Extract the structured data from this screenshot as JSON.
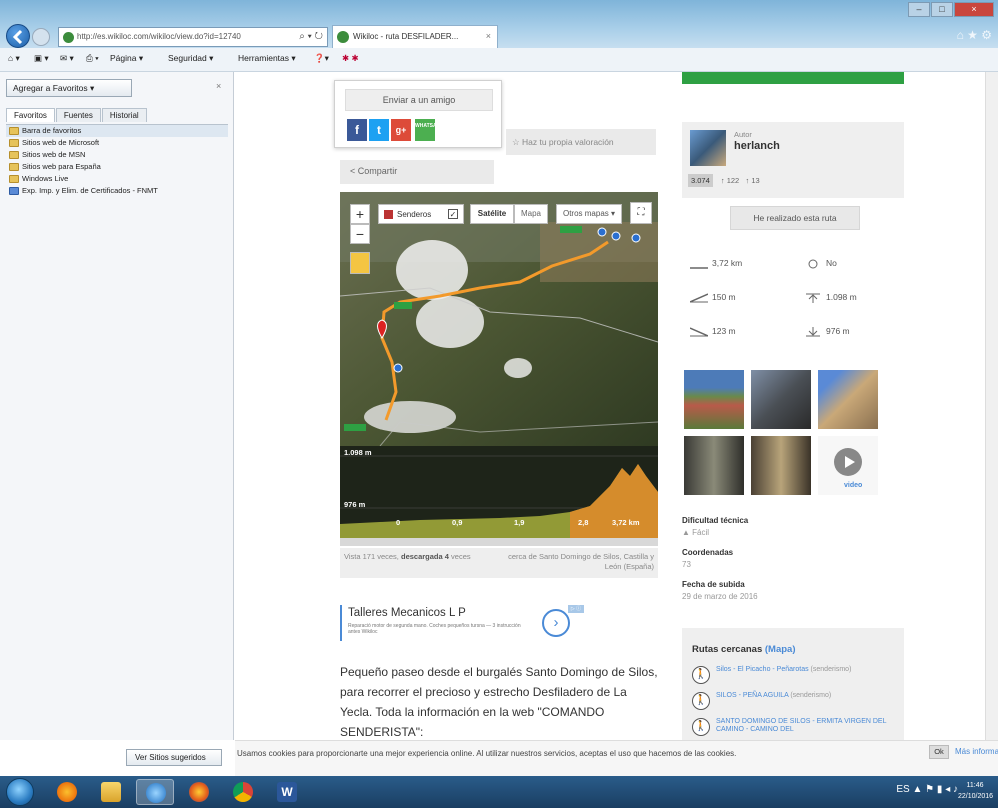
{
  "browser": {
    "address_url": "http://es.wikiloc.com/wikiloc/view.do?id=12740",
    "tab_title": "Wikiloc - ruta DESFILADER...",
    "cmd_items": [
      "Página ▾",
      "Seguridad ▾",
      "Herramientas ▾"
    ]
  },
  "favorites": {
    "add_button": "Agregar a Favoritos",
    "tabs": [
      "Favoritos",
      "Fuentes",
      "Historial"
    ],
    "items": [
      "Barra de favoritos",
      "Sitios web de Microsoft",
      "Sitios web de MSN",
      "Sitios web para España",
      "Windows Live",
      "Exp. Imp. y Elim. de Certificados - FNMT"
    ],
    "suggest_button": "Ver Sitios sugeridos"
  },
  "share": {
    "email_button": "Enviar a un amigo",
    "facebook": "f",
    "twitter": "t",
    "gplus": "g+",
    "whatsapp": "WHATSAPP",
    "compartir": "Compartir",
    "valorar": "Haz tu propia valoración"
  },
  "map": {
    "zoom_in": "+",
    "zoom_out": "−",
    "layer_label": "Senderos",
    "layer_check": "✓",
    "satellite": "Satélite",
    "map_view": "Mapa",
    "other_maps": "Otros mapas ▾",
    "fullscreen": "⛶",
    "profile_top": "1.098 m",
    "profile_bottom": "976 m",
    "x_ticks": [
      "0",
      "0,9",
      "1,9",
      "2,8",
      "3,72 km"
    ]
  },
  "views": {
    "prefix": "Vista 171 veces, ",
    "bold": "descargada 4",
    "suffix": " veces",
    "location": "cerca de Santo Domingo de Silos, Castilla y León (España)"
  },
  "ad": {
    "title": "Talleres Mecanicos L P",
    "sub": "Reparació motor de segunda mano. Coches pequeños tursna — 3 instrucción antes Wikiloc",
    "badge": "▷ ⓘ"
  },
  "description": "Pequeño paseo desde el burgalés Santo Domingo de Silos, para recorrer el precioso y estrecho Desfiladero de La Yecla. Toda la información en la web \"COMANDO SENDERISTA\":",
  "author": {
    "label": "Autor",
    "name": "herlanch",
    "points": "3.074",
    "followers": "↑ 122",
    "following": "↑ 13",
    "done_button": "He realizado esta ruta"
  },
  "stats": {
    "distance": "3,72 km",
    "loop": "No",
    "ascent": "150 m",
    "max_alt": "1.098 m",
    "descent": "123 m",
    "min_alt": "976 m"
  },
  "video_label": "video",
  "meta": {
    "difficulty_h": "Dificultad técnica",
    "difficulty_v": "▲ Fácil",
    "coords_h": "Coordenadas",
    "coords_v": "73",
    "date_h": "Fecha de subida",
    "date_v": "29 de marzo de 2016"
  },
  "nearby": {
    "heading": "Rutas cercanas ",
    "map_link": "(Mapa)",
    "items": [
      {
        "name": "Silos - El Picacho - Peñarotas",
        "type": " (senderismo)"
      },
      {
        "name": "SILOS - PEÑA AGUILA",
        "type": " (senderismo)"
      },
      {
        "name": "SANTO DOMINGO DE SILOS - ERMITA VIRGEN DEL CAMINO - CAMINO DEL",
        "type": ""
      }
    ]
  },
  "cookie": {
    "text": "Usamos cookies para proporcionarte una mejor experiencia online. Al utilizar nuestros servicios, aceptas el uso que hacemos de las cookies.",
    "ok": "Ok",
    "more": "Más información"
  },
  "taskbar": {
    "clock_time": "11:46",
    "clock_date": "22/10/2016",
    "word_label": "W"
  }
}
